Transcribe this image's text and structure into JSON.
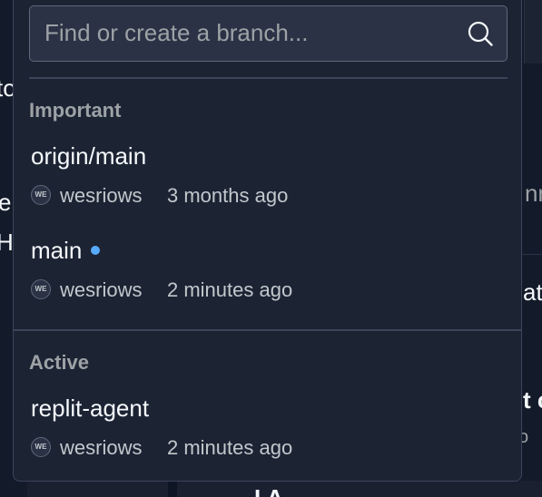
{
  "background": {
    "fragments": [
      "to",
      "e",
      "H",
      "nn",
      "ati",
      "t c",
      "o",
      "I A"
    ]
  },
  "search": {
    "placeholder": "Find or create a branch...",
    "value": "",
    "icon": "search-icon"
  },
  "sections": [
    {
      "label": "Important",
      "branches": [
        {
          "name": "origin/main",
          "avatar_initials": "WE",
          "author": "wesriows",
          "time": "3 months ago",
          "current": false
        },
        {
          "name": "main",
          "avatar_initials": "WE",
          "author": "wesriows",
          "time": "2 minutes ago",
          "current": true
        }
      ]
    },
    {
      "label": "Active",
      "branches": [
        {
          "name": "replit-agent",
          "avatar_initials": "WE",
          "author": "wesriows",
          "time": "2 minutes ago",
          "current": false
        }
      ]
    }
  ],
  "colors": {
    "current_branch_dot": "#57abff",
    "popover_background": "#1c2333"
  }
}
